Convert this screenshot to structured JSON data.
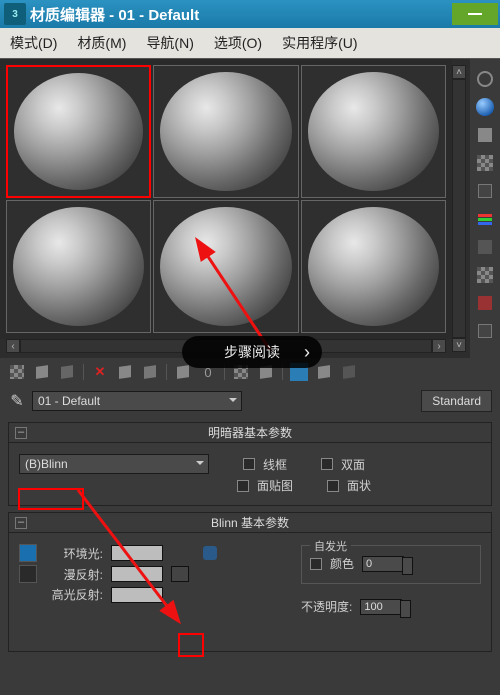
{
  "titlebar": {
    "title": "材质编辑器 - 01 - Default"
  },
  "menu": {
    "mode": "模式(D)",
    "material": "材质(M)",
    "navigation": "导航(N)",
    "options": "选项(O)",
    "utilities": "实用程序(U)"
  },
  "step_badge": "步骤阅读",
  "material_name": "01 - Default",
  "material_type_button": "Standard",
  "shader_rollout": {
    "title": "明暗器基本参数",
    "shader_combo": "(B)Blinn",
    "wireframe": "线框",
    "two_sided": "双面",
    "face_map": "面贴图",
    "faceted": "面状"
  },
  "blinn_rollout": {
    "title": "Blinn 基本参数",
    "ambient": "环境光:",
    "diffuse": "漫反射:",
    "specular": "高光反射:",
    "self_illum_group": "自发光",
    "color_label": "颜色",
    "color_value": "0",
    "opacity_label": "不透明度:",
    "opacity_value": "100"
  }
}
